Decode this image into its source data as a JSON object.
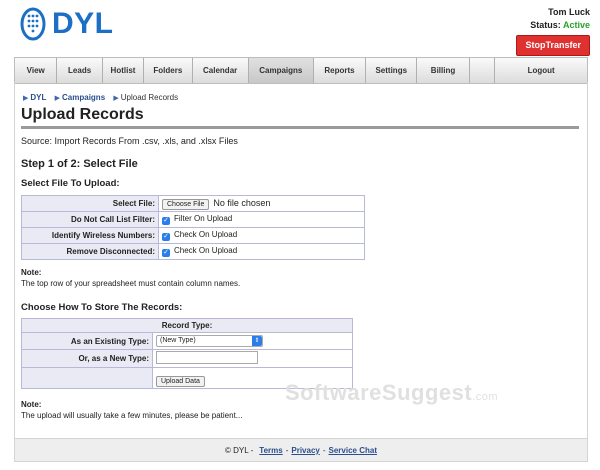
{
  "header": {
    "logo_text": "DYL",
    "user_name": "Tom Luck",
    "status_label": "Status:",
    "status_value": "Active",
    "stop_prefix": "Stop",
    "stop_bold": "Transfer",
    "colors": {
      "brand": "#1b6fc4",
      "active": "#2aa02a",
      "stop": "#e03131"
    }
  },
  "nav": {
    "items": [
      "View",
      "Leads",
      "Hotlist",
      "Folders",
      "Calendar",
      "Campaigns",
      "Reports",
      "Settings",
      "Billing",
      "",
      "Logout"
    ],
    "active": "Campaigns"
  },
  "breadcrumb": {
    "items": [
      "DYL",
      "Campaigns"
    ],
    "current": "Upload Records"
  },
  "page": {
    "title": "Upload Records",
    "source": "Source: Import Records From .csv, .xls, and .xlsx Files",
    "step": "Step 1 of 2: Select File",
    "select_file_heading": "Select File To Upload:"
  },
  "form1": {
    "select_file_label": "Select File:",
    "choose_file_button": "Choose File",
    "file_status": "No file chosen",
    "dnc_label": "Do Not Call List Filter:",
    "dnc_option": "Filter On Upload",
    "wireless_label": "Identify Wireless Numbers:",
    "wireless_option": "Check On Upload",
    "disconnected_label": "Remove Disconnected:",
    "disconnected_option": "Check On Upload"
  },
  "note1": {
    "label": "Note:",
    "text": "The top row of your spreadsheet must contain column names."
  },
  "store": {
    "heading": "Choose How To Store The Records:",
    "record_type_header": "Record Type:",
    "existing_label": "As an Existing Type:",
    "existing_value": "(New Type)",
    "new_label": "Or, as a New Type:",
    "new_value": "",
    "upload_button": "Upload Data"
  },
  "note2": {
    "label": "Note:",
    "text": "The upload will usually take a few minutes, please be patient..."
  },
  "watermark": {
    "main": "SoftwareSuggest",
    "suffix": ".com"
  },
  "footer": {
    "copyright": "© DYL -",
    "links": [
      "Terms",
      "Privacy",
      "Service Chat"
    ]
  }
}
